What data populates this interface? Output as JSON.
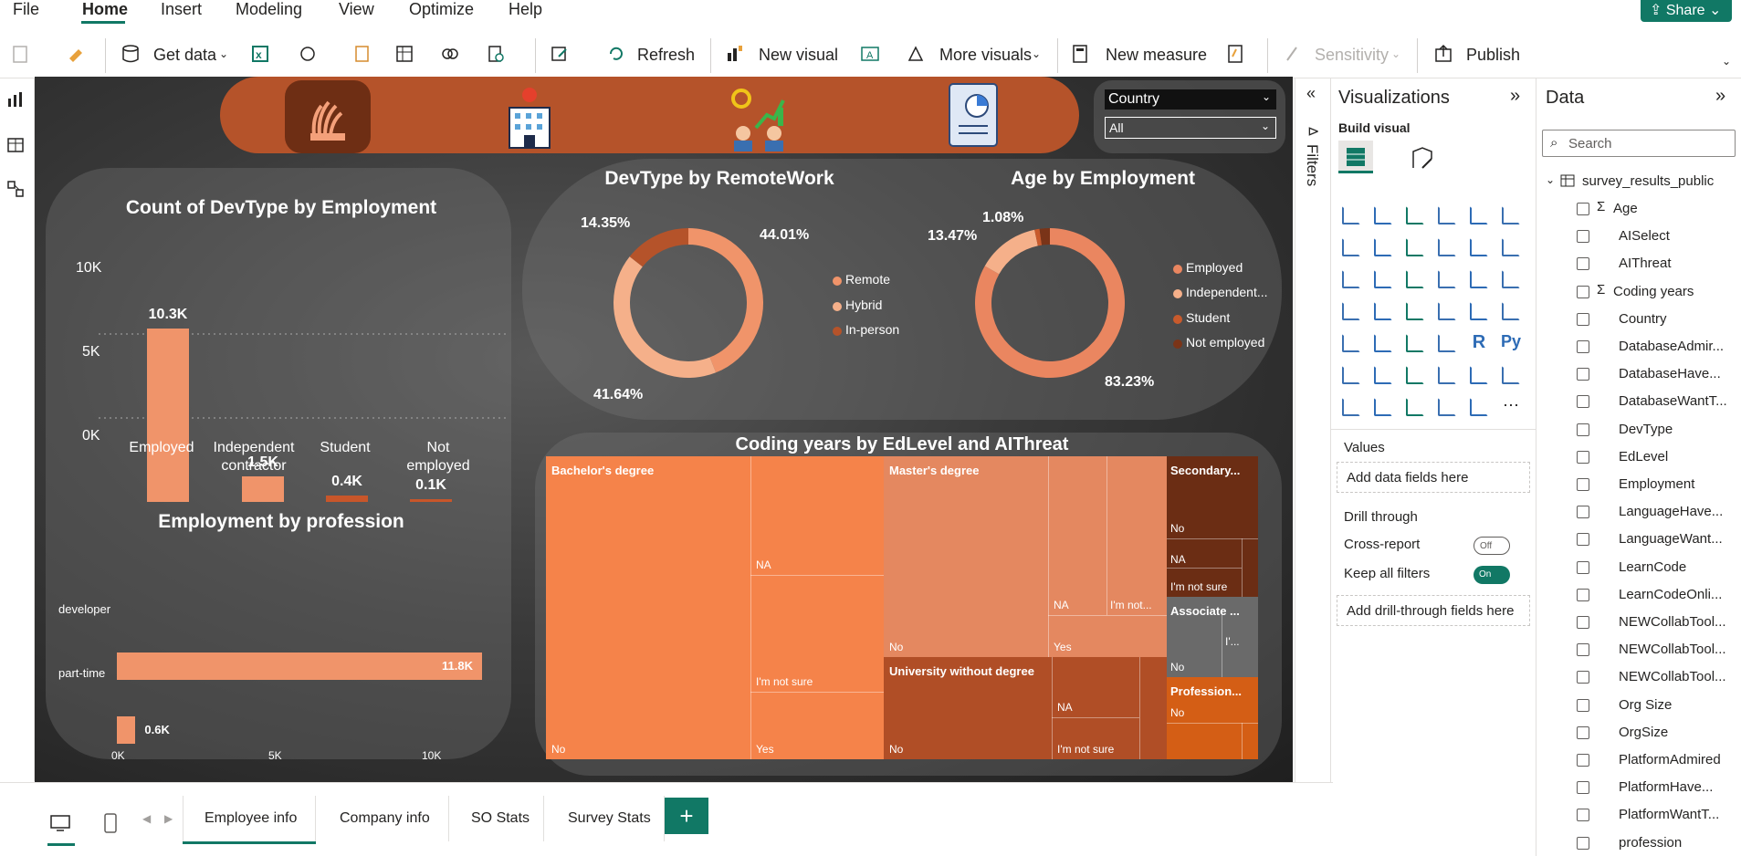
{
  "menu": {
    "items": [
      "File",
      "Home",
      "Insert",
      "Modeling",
      "View",
      "Optimize",
      "Help"
    ],
    "active": "Home",
    "share_label": "Share"
  },
  "ribbon": {
    "get_data": "Get data",
    "refresh": "Refresh",
    "new_visual": "New visual",
    "more_visuals": "More visuals",
    "new_measure": "New measure",
    "sensitivity": "Sensitivity",
    "publish": "Publish"
  },
  "slicer": {
    "label": "Country",
    "value": "All"
  },
  "charts": {
    "employment_count": {
      "title": "Count of DevType by Employment",
      "yticks": [
        "10K",
        "5K",
        "0K"
      ],
      "labels": [
        "10.3K",
        "1.5K",
        "0.4K",
        "0.1K"
      ],
      "categories": [
        "Employed",
        "Independent",
        "contractor",
        "Student",
        "Not",
        "employed"
      ]
    },
    "remote": {
      "title": "DevType by RemoteWork",
      "pcts": [
        "44.01%",
        "41.64%",
        "14.35%"
      ],
      "legend": [
        "Remote",
        "Hybrid",
        "In-person"
      ]
    },
    "age": {
      "title": "Age by Employment",
      "pcts": [
        "83.23%",
        "13.47%",
        "1.08%"
      ],
      "legend": [
        "Employed",
        "Independent...",
        "Student",
        "Not employed"
      ]
    },
    "profession": {
      "title": "Employment by profession",
      "cats": [
        "developer",
        "part-time"
      ],
      "labels": [
        "11.8K",
        "0.6K"
      ],
      "xticks": [
        "0K",
        "5K",
        "10K"
      ]
    },
    "treemap": {
      "title": "Coding years by EdLevel and AIThreat"
    }
  },
  "chart_data": [
    {
      "type": "bar",
      "title": "Count of DevType by Employment",
      "categories": [
        "Employed",
        "Independent contractor",
        "Student",
        "Not employed"
      ],
      "values": [
        10300,
        1500,
        400,
        100
      ],
      "ylim": [
        0,
        10000
      ]
    },
    {
      "type": "pie",
      "title": "DevType by RemoteWork",
      "categories": [
        "Remote",
        "Hybrid",
        "In-person"
      ],
      "values": [
        44.01,
        41.64,
        14.35
      ]
    },
    {
      "type": "pie",
      "title": "Age by Employment",
      "categories": [
        "Employed",
        "Independent contractor",
        "Student",
        "Not employed"
      ],
      "values": [
        83.23,
        13.47,
        1.08,
        2.22
      ]
    },
    {
      "type": "bar",
      "title": "Employment by profession",
      "categories": [
        "developer",
        "part-time"
      ],
      "values": [
        11800,
        600
      ],
      "xlim": [
        0,
        10000
      ]
    }
  ],
  "treemap": {
    "bachelor": "Bachelor's degree",
    "master": "Master's degree",
    "secondary": "Secondary...",
    "associate": "Associate ...",
    "university": "University without degree",
    "professional": "Profession...",
    "no": "No",
    "na": "NA",
    "notsure": "I'm not sure",
    "yes": "Yes",
    "notsure_short": "I'm not...",
    "i_short": "I'..."
  },
  "panes": {
    "filters": "Filters",
    "visualizations": "Visualizations",
    "build_visual": "Build visual",
    "values": "Values",
    "add_data": "Add data fields here",
    "drill_through": "Drill through",
    "cross_report": "Cross-report",
    "cross_state": "Off",
    "keep_filters": "Keep all filters",
    "keep_state": "On",
    "add_drill": "Add drill-through fields here",
    "data": "Data",
    "search": "Search",
    "table": "survey_results_public",
    "fields": [
      "Age",
      "AISelect",
      "AIThreat",
      "Coding years",
      "Country",
      "DatabaseAdmir...",
      "DatabaseHave...",
      "DatabaseWantT...",
      "DevType",
      "EdLevel",
      "Employment",
      "LanguageHave...",
      "LanguageWant...",
      "LearnCode",
      "LearnCodeOnli...",
      "NEWCollabTool...",
      "NEWCollabTool...",
      "NEWCollabTool...",
      "Org Size",
      "OrgSize",
      "PlatformAdmired",
      "PlatformHave...",
      "PlatformWantT...",
      "profession"
    ],
    "sigma_fields": [
      "Age",
      "Coding years"
    ]
  },
  "tabs": [
    "Employee info",
    "Company info",
    "SO Stats",
    "Survey Stats"
  ],
  "colors": {
    "accent": "#117865",
    "orange_light": "#f08a5d",
    "orange_main": "#ea8660",
    "orange_dark": "#b5532a"
  }
}
